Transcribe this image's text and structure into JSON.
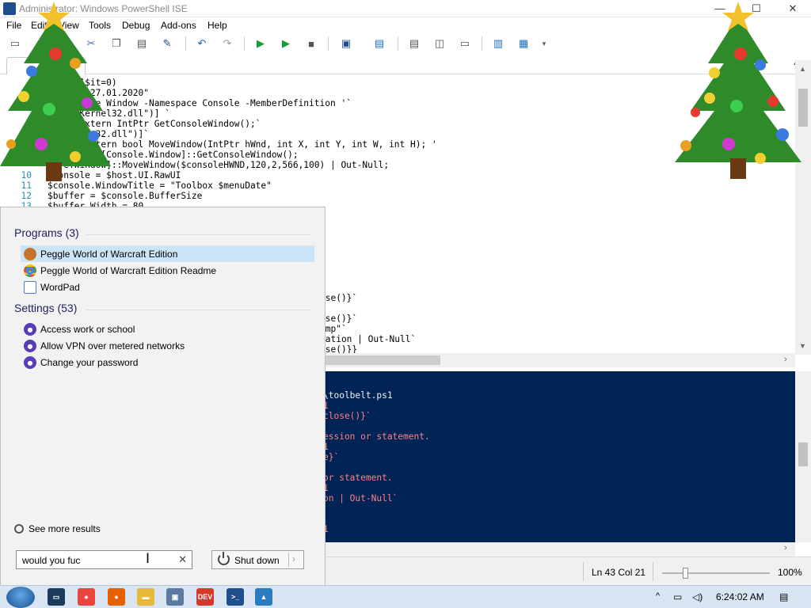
{
  "window": {
    "title": "Administrator: Windows PowerShell ISE",
    "minimize_glyph": "—",
    "maximize_glyph": "☐",
    "close_glyph": "✕"
  },
  "menu": [
    "File",
    "Edit",
    "View",
    "Tools",
    "Debug",
    "Add-ons",
    "Help"
  ],
  "toolbar_icons": [
    "new-icon",
    "open-icon",
    "save-icon",
    "cut-icon",
    "copy-icon",
    "paste-icon",
    "clear-icon",
    "undo-icon",
    "redo-icon",
    "run-icon",
    "run-selection-icon",
    "stop-icon",
    "new-remote-tab-icon",
    "start-powershell-icon",
    "show-script-top-icon",
    "show-script-right-icon",
    "show-script-max-icon",
    "show-command-icon",
    "show-addon-icon",
    "toolbar-overflow-icon"
  ],
  "script_lines": [
    {
      "n": "",
      "text": "[int32]$it=0)"
    },
    {
      "n": "",
      "text": "     = \"27.01.2020\""
    },
    {
      "n": "",
      "text": "     -Name Window -Namespace Console -MemberDefinition '`"
    },
    {
      "n": "",
      "text": "  rt(\"Kernel32.dll\")] `"
    },
    {
      "n": "",
      "text": "   ic extern IntPtr GetConsoleWindow();`"
    },
    {
      "n": "",
      "text": "   (\"user32.dll\")]`"
    },
    {
      "n": "",
      "text": "   tic extern bool MoveWindow(IntPtr hWnd, int X, int Y, int W, int H); '"
    },
    {
      "n": "",
      "text": "      D = [Console.Window]::GetConsoleWindow();"
    },
    {
      "n": "",
      "text": "   e.Window]::MoveWindow($consoleHWND,120,2,566,100) | Out-Null;"
    },
    {
      "n": "10",
      "text": "$console = $host.UI.RawUI"
    },
    {
      "n": "11",
      "text": "$console.WindowTitle = \"Toolbox $menuDate\""
    },
    {
      "n": "12",
      "text": "$buffer = $console.BufferSize"
    },
    {
      "n": "13",
      "text": "$buffer.Width = 80"
    }
  ],
  "script_tail_lines": [
    "ose()}`",
    "ose()}`",
    "emp\"`",
    "nation | Out-Null`",
    "ose()}}"
  ],
  "console_lines": [
    {
      "text": "\\toolbelt.ps1",
      "kind": "white"
    },
    {
      "text": "1",
      "kind": "err"
    },
    {
      "text": "close()}`",
      "kind": "err"
    },
    {
      "text": "ession or statement.",
      "kind": "err"
    },
    {
      "text": "1",
      "kind": "err"
    },
    {
      "text": "e}`",
      "kind": "err"
    },
    {
      "text": "or statement.",
      "kind": "err"
    },
    {
      "text": "1",
      "kind": "err"
    },
    {
      "text": "on | Out-Null`",
      "kind": "err"
    },
    {
      "text": "1",
      "kind": "err"
    }
  ],
  "status": {
    "position": "Ln 43  Col 21",
    "zoom": "100%",
    "zoom_level_percent": 100
  },
  "start_menu": {
    "programs_header": "Programs (3)",
    "programs": [
      {
        "label": "Peggle World of Warcraft Edition",
        "icon": "peggle-icon",
        "color": "#c8722a"
      },
      {
        "label": "Peggle World of Warcraft Edition Readme",
        "icon": "chrome-icon",
        "color": "#e8453c"
      },
      {
        "label": "WordPad",
        "icon": "wordpad-icon",
        "color": "#4a7fc1"
      }
    ],
    "settings_header": "Settings (53)",
    "settings": [
      {
        "label": "Access work or school",
        "icon": "settings-gear-icon"
      },
      {
        "label": "Allow VPN over metered networks",
        "icon": "settings-gear-icon"
      },
      {
        "label": "Change your password",
        "icon": "settings-gear-icon"
      }
    ],
    "see_more": "See more results",
    "search_value": "would you fuc",
    "shutdown_label": "Shut down"
  },
  "taskbar": {
    "apps": [
      {
        "name": "task-view-icon",
        "color": "#1b3a5c",
        "glyph": "▭"
      },
      {
        "name": "chrome-icon",
        "color": "#e8453c",
        "glyph": "●"
      },
      {
        "name": "firefox-icon",
        "color": "#e66000",
        "glyph": "●"
      },
      {
        "name": "file-explorer-icon",
        "color": "#e8b83a",
        "glyph": "▬"
      },
      {
        "name": "remote-desktop-icon",
        "color": "#5a7aa0",
        "glyph": "▣"
      },
      {
        "name": "devcpp-icon",
        "color": "#d33a2c",
        "glyph": "DEV"
      },
      {
        "name": "powershell-icon",
        "color": "#1e4e8c",
        "glyph": ">_"
      },
      {
        "name": "powershell-ise-icon",
        "color": "#2b7bbf",
        "glyph": "▲"
      }
    ],
    "clock": "6:24:02 AM"
  },
  "colors": {
    "console_bg": "#012456",
    "selection": "#cce4f7",
    "tree_green": "#2f8a2a"
  }
}
